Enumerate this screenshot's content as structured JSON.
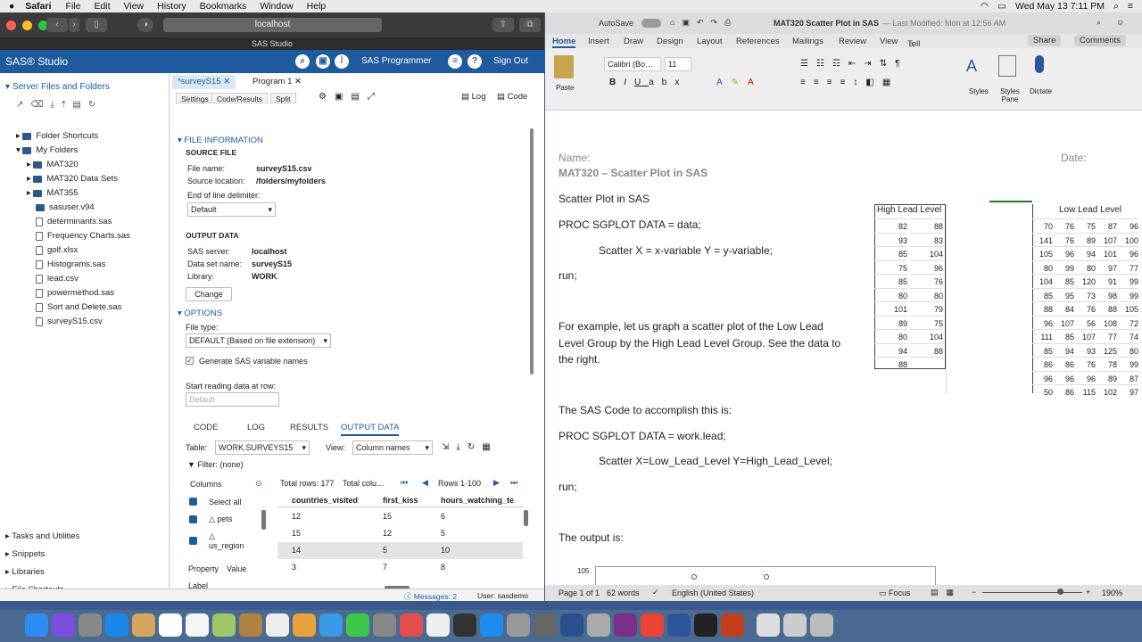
{
  "menubar": {
    "app": "Safari",
    "items": [
      "File",
      "Edit",
      "View",
      "History",
      "Bookmarks",
      "Window",
      "Help"
    ],
    "clock": "Wed May 13  7:11 PM"
  },
  "safari": {
    "url": "localhost",
    "tab_title": "SAS Studio"
  },
  "sas": {
    "brand": "SAS® Studio",
    "mode": "SAS Programmer",
    "signout": "Sign Out",
    "nav_title": "Server Files and Folders",
    "tree": [
      {
        "label": "Folder Shortcuts"
      },
      {
        "label": "My Folders"
      },
      {
        "label": "MAT320"
      },
      {
        "label": "MAT320 Data Sets"
      },
      {
        "label": "MAT355"
      },
      {
        "label": "sasuser.v94"
      },
      {
        "label": "determinants.sas"
      },
      {
        "label": "Frequency Charts.sas"
      },
      {
        "label": "golf.xlsx"
      },
      {
        "label": "Histograms.sas"
      },
      {
        "label": "lead.csv"
      },
      {
        "label": "powermethod.sas"
      },
      {
        "label": "Sort and Delete.sas"
      },
      {
        "label": "surveyS15.csv"
      }
    ],
    "bottom_nav": [
      "Tasks and Utilities",
      "Snippets",
      "Libraries",
      "File Shortcuts"
    ],
    "tabs": [
      "*surveyS15",
      "Program 1"
    ],
    "subtabs": [
      "Settings",
      "Code/Results",
      "Split"
    ],
    "log_label": "Log",
    "code_label": "Code",
    "file_info_title": "FILE INFORMATION",
    "source_file_title": "SOURCE FILE",
    "file_name_label": "File name:",
    "file_name": "surveyS15.csv",
    "source_location_label": "Source location:",
    "source_location": "/folders/myfolders",
    "eol_label": "End of line delimiter:",
    "eol_value": "Default",
    "output_data_title": "OUTPUT DATA",
    "sas_server_label": "SAS server:",
    "sas_server": "localhost",
    "dataset_label": "Data set name:",
    "dataset": "surveyS15",
    "library_label": "Library:",
    "library": "WORK",
    "change_button": "Change",
    "options_title": "OPTIONS",
    "file_type_label": "File type:",
    "file_type": "DEFAULT (Based on file extension)",
    "gen_names": "Generate SAS variable names",
    "start_row_label": "Start reading data at row:",
    "start_row_placeholder": "Default",
    "out_tabs": [
      "CODE",
      "LOG",
      "RESULTS",
      "OUTPUT DATA"
    ],
    "table_label": "Table:",
    "table_value": "WORK.SURVEYS15",
    "view_label": "View:",
    "view_value": "Column names",
    "filter_label": "Filter:",
    "filter_value": "(none)",
    "columns_label": "Columns",
    "select_all": "Select all",
    "col_items": [
      "pets",
      "us_region"
    ],
    "prop_label": "Property",
    "value_label": "Value",
    "label_label": "Label",
    "total_rows": "Total rows: 177",
    "total_cols": "Total colu…",
    "rows_range": "Rows 1-100",
    "grid_headers": [
      "countries_visited",
      "first_kiss",
      "hours_watching_te"
    ],
    "grid_rows": [
      [
        "12",
        "15",
        "6"
      ],
      [
        "15",
        "12",
        "5"
      ],
      [
        "14",
        "5",
        "10"
      ],
      [
        "3",
        "7",
        "8"
      ]
    ],
    "messages": "Messages: 2",
    "user": "User: sasdemo"
  },
  "word": {
    "title": "MAT320 Scatter Plot in SAS",
    "title_suffix": "— Last Modified: Mon at 12:56 AM",
    "autosave": "AutoSave",
    "menu": [
      "Home",
      "Insert",
      "Draw",
      "Design",
      "Layout",
      "References",
      "Mailings",
      "Review",
      "View",
      "Tell me"
    ],
    "share": "Share",
    "comments": "Comments",
    "font_name": "Calibri (Bo…",
    "font_size": "11",
    "paste": "Paste",
    "styles": "Styles",
    "styles_pane": "Styles Pane",
    "dictate": "Dictate",
    "name_label": "Name:",
    "date_label": "Date:",
    "doc_title": "MAT320 – Scatter Plot in SAS",
    "lines": [
      "Scatter Plot in SAS",
      "PROC SGPLOT DATA = data;",
      "Scatter X = x-variable Y = y-variable;",
      "run;",
      "For example, let us graph a scatter plot of the Low Lead",
      "Level Group by the High Lead Level Group.  See the data to",
      "the right.",
      "The SAS Code to accomplish this is:",
      "PROC SGPLOT DATA = work.lead;",
      "Scatter X=Low_Lead_Level Y=High_Lead_Level;",
      "run;",
      "The output is:"
    ],
    "high_header": "High Lead Level",
    "low_header": "Low Lead Level",
    "high_values": [
      [
        "82",
        "88"
      ],
      [
        "93",
        "83"
      ],
      [
        "85",
        "104"
      ],
      [
        "75",
        "96"
      ],
      [
        "85",
        "76"
      ],
      [
        "80",
        "80"
      ],
      [
        "101",
        "79"
      ],
      [
        "89",
        "75"
      ],
      [
        "80",
        "104"
      ],
      [
        "94",
        "88"
      ],
      [
        "88",
        ""
      ]
    ],
    "low_values": [
      [
        "70",
        "76",
        "75",
        "87",
        "96"
      ],
      [
        "141",
        "76",
        "89",
        "107",
        "100"
      ],
      [
        "105",
        "96",
        "94",
        "101",
        "96"
      ],
      [
        "80",
        "99",
        "80",
        "97",
        "77"
      ],
      [
        "104",
        "85",
        "120",
        "91",
        "99"
      ],
      [
        "85",
        "95",
        "73",
        "98",
        "99"
      ],
      [
        "88",
        "84",
        "76",
        "88",
        "105"
      ],
      [
        "96",
        "107",
        "56",
        "108",
        "72"
      ],
      [
        "111",
        "85",
        "107",
        "77",
        "74"
      ],
      [
        "85",
        "94",
        "93",
        "125",
        "80"
      ],
      [
        "86",
        "86",
        "76",
        "78",
        "99"
      ],
      [
        "96",
        "96",
        "96",
        "89",
        "87"
      ],
      [
        "50",
        "86",
        "115",
        "102",
        "97"
      ]
    ],
    "chart_tick": "105",
    "status_page": "Page 1 of 1",
    "status_words": "62 words",
    "status_lang": "English (United States)",
    "focus": "Focus",
    "zoom": "190%"
  }
}
